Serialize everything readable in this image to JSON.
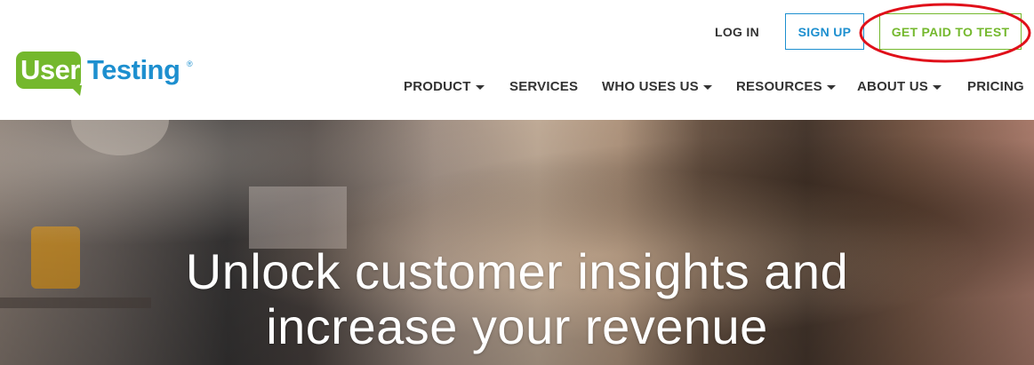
{
  "logo": {
    "user": "User",
    "testing": "Testing",
    "reg": "®"
  },
  "top_nav": {
    "login": "LOG IN",
    "signup": "SIGN UP",
    "get_paid": "GET PAID TO TEST"
  },
  "main_nav": [
    {
      "label": "PRODUCT",
      "dropdown": true
    },
    {
      "label": "SERVICES",
      "dropdown": false
    },
    {
      "label": "WHO USES US",
      "dropdown": true
    },
    {
      "label": "RESOURCES",
      "dropdown": true
    },
    {
      "label": "ABOUT US",
      "dropdown": true
    },
    {
      "label": "PRICING",
      "dropdown": false
    }
  ],
  "hero": {
    "line1": "Unlock customer insights and",
    "line2": "increase your revenue"
  },
  "colors": {
    "brand_green": "#74b82d",
    "brand_blue": "#1d8fcf",
    "annotation_red": "#e0101a"
  }
}
